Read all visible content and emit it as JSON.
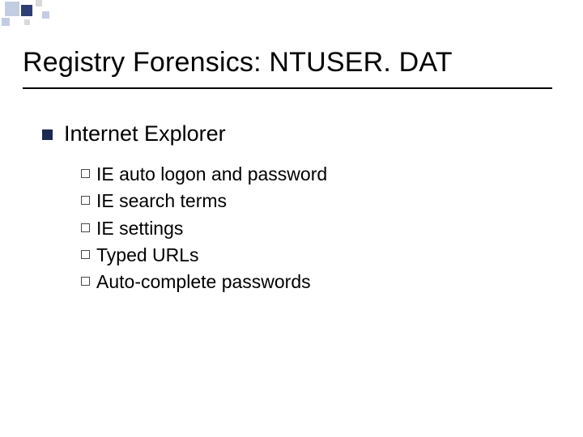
{
  "title": "Registry Forensics: NTUSER. DAT",
  "section": {
    "heading": "Internet Explorer",
    "items": [
      "IE auto logon and password",
      "IE search terms",
      "IE settings",
      "Typed URLs",
      "Auto-complete passwords"
    ]
  }
}
